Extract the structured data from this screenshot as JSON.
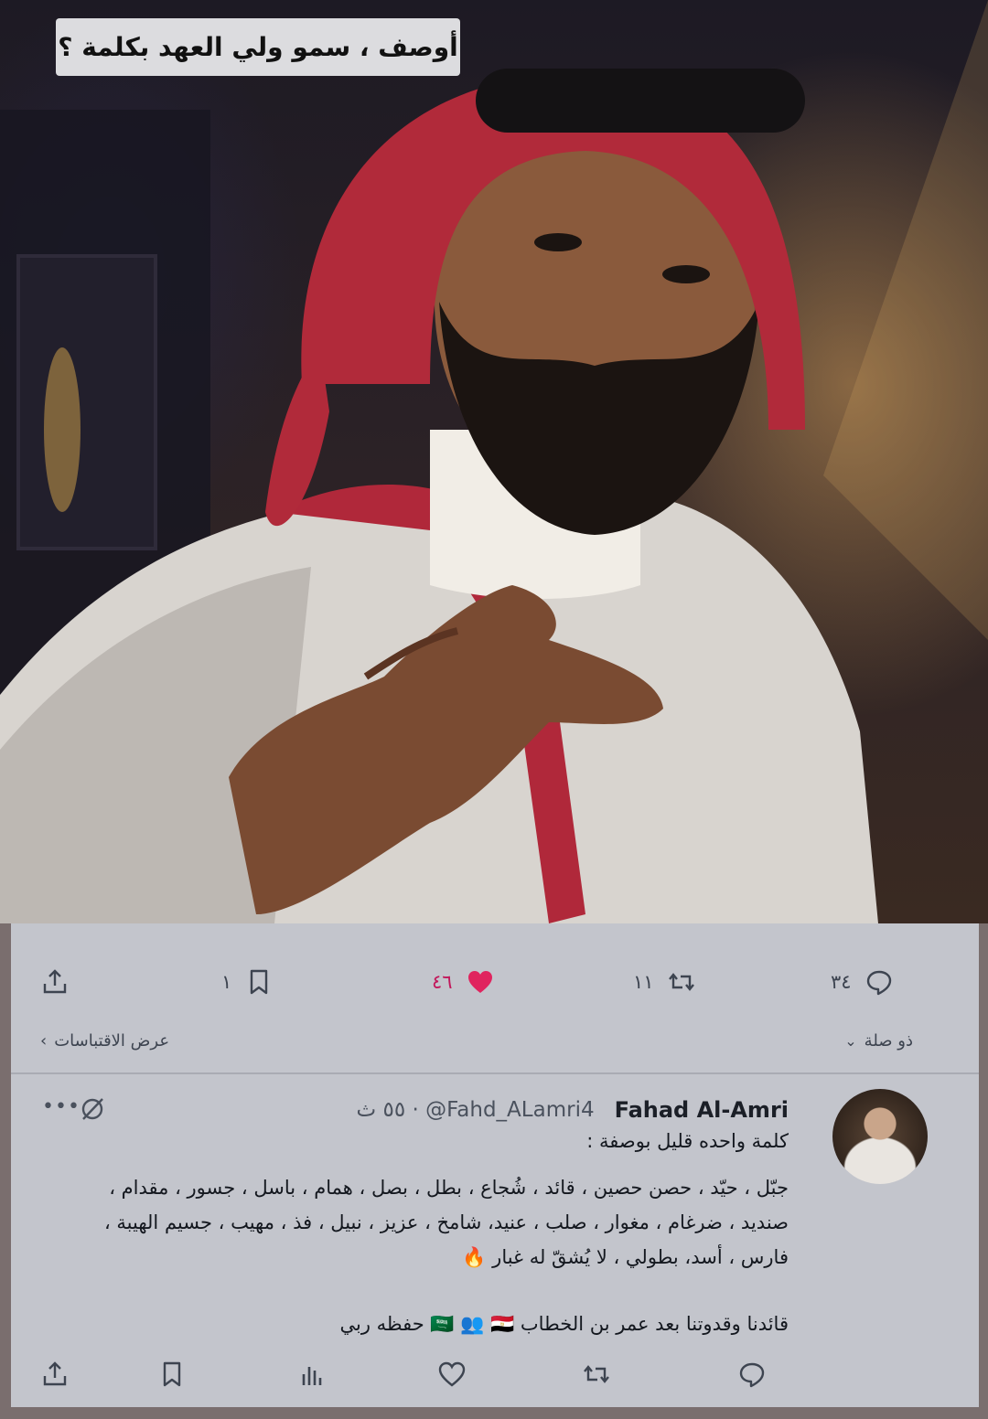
{
  "photo": {
    "caption": "أوصف ، سمو ولي العهد بكلمة ؟",
    "alt": "portrait"
  },
  "tweet": {
    "stats": {
      "replies": "٣٤",
      "retweets": "١١",
      "likes": "٤٦",
      "bookmarks": "١"
    },
    "related_label": "ذو صلة",
    "quotes_label": "عرض الاقتباسات"
  },
  "reply": {
    "author_name": "Fahad Al-Amri",
    "handle": "@Fahd_ALamri4",
    "time": "٥٥ ث",
    "separator": "·",
    "lines": [
      "كلمة واحده قليل بوصفة :",
      "جبّل ، حيّد ، حصن حصين ، قائد ، شُجاع ، بطل ، بصل ، همام ، باسل ، جسور ، مقدام ،",
      "صنديد ، ضرغام ، مغوار ، صلب ، عنيد، شامخ ، عزيز ، نبيل ، فذ ، مهيب ، جسيم الهيبة ،",
      "فارس ، أسد، بطولي ، لا يُشقّ له غبار 🔥",
      "قائدنا وقدوتنا بعد عمر بن الخطاب 🇸🇦 👥 🇪🇬   حفظه ربي"
    ]
  },
  "colors": {
    "card_bg": "#c3c5cc",
    "like_pink": "#e0245e",
    "text_dark": "#14181f",
    "text_muted": "#4a515d"
  }
}
